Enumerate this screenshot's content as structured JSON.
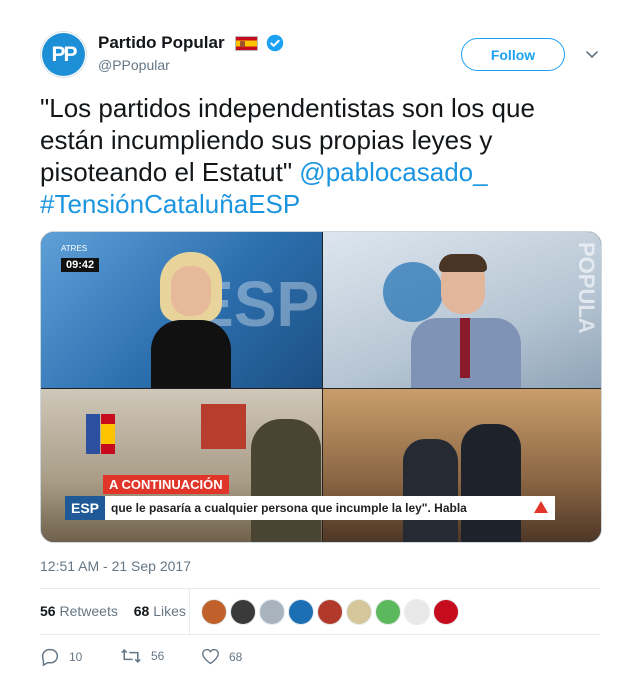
{
  "author": {
    "display_name": "Partido Popular",
    "handle": "@PPopular",
    "avatar_text": "PP",
    "verified": true
  },
  "follow_label": "Follow",
  "tweet": {
    "text": "\"Los partidos independentistas son los que están incumpliendo sus propias leyes y pisoteando el Estatut\" ",
    "mention": "@pablocasado_",
    "hashtag": "#TensiónCataluñaESP"
  },
  "media": {
    "clock": "09:42",
    "channel_small": "ATRES",
    "background_text": "ESP",
    "wall_text": "POPULA",
    "banner": "A CONTINUACIÓN",
    "ticker_tag": "ESP",
    "ticker": "que le pasaría a cualquier persona que incumple la ley\". Habla"
  },
  "timestamp": "12:51 AM - 21 Sep 2017",
  "stats": {
    "retweets_count": "56",
    "retweets_label": "Retweets",
    "likes_count": "68",
    "likes_label": "Likes"
  },
  "likers_colors": [
    "#c0612b",
    "#3a3a3a",
    "#aab4bf",
    "#1d6fb3",
    "#b23a2c",
    "#d6c79a",
    "#5cb85c",
    "#e9e9e9",
    "#c60b1e"
  ],
  "actions": {
    "replies": "10",
    "retweets": "56",
    "likes": "68"
  },
  "colors": {
    "link": "#1b95e0",
    "follow": "#1da1f2",
    "muted": "#657786"
  }
}
